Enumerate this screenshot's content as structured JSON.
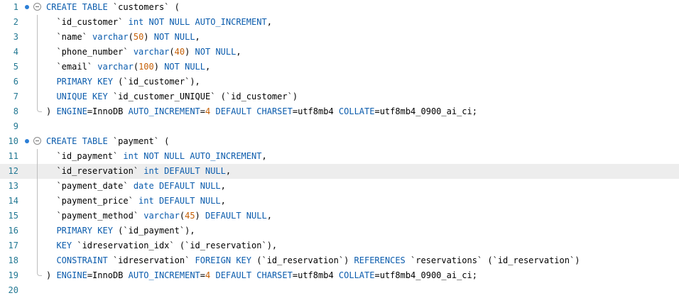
{
  "editor": {
    "highlighted_line": 12,
    "colors": {
      "keyword": "#0b5cad",
      "identifier": "#000000",
      "number": "#c55f05",
      "line_number": "#237893",
      "breakpoint": "#2c7fd6"
    },
    "lines": [
      {
        "n": "1",
        "bp": true,
        "fold": "open",
        "tokens": [
          [
            "kw",
            "CREATE TABLE "
          ],
          [
            "id",
            "`customers` "
          ],
          [
            "pl",
            "("
          ]
        ]
      },
      {
        "n": "2",
        "fold": "guide",
        "tokens": [
          [
            "pl",
            "  "
          ],
          [
            "id",
            "`id_customer` "
          ],
          [
            "kw",
            "int NOT NULL AUTO_INCREMENT"
          ],
          [
            "pl",
            ","
          ]
        ]
      },
      {
        "n": "3",
        "fold": "guide",
        "tokens": [
          [
            "pl",
            "  "
          ],
          [
            "id",
            "`name` "
          ],
          [
            "kw",
            "varchar"
          ],
          [
            "pl",
            "("
          ],
          [
            "num",
            "50"
          ],
          [
            "pl",
            ") "
          ],
          [
            "kw",
            "NOT NULL"
          ],
          [
            "pl",
            ","
          ]
        ]
      },
      {
        "n": "4",
        "fold": "guide",
        "tokens": [
          [
            "pl",
            "  "
          ],
          [
            "id",
            "`phone_number` "
          ],
          [
            "kw",
            "varchar"
          ],
          [
            "pl",
            "("
          ],
          [
            "num",
            "40"
          ],
          [
            "pl",
            ") "
          ],
          [
            "kw",
            "NOT NULL"
          ],
          [
            "pl",
            ","
          ]
        ]
      },
      {
        "n": "5",
        "fold": "guide",
        "tokens": [
          [
            "pl",
            "  "
          ],
          [
            "id",
            "`email` "
          ],
          [
            "kw",
            "varchar"
          ],
          [
            "pl",
            "("
          ],
          [
            "num",
            "100"
          ],
          [
            "pl",
            ") "
          ],
          [
            "kw",
            "NOT NULL"
          ],
          [
            "pl",
            ","
          ]
        ]
      },
      {
        "n": "6",
        "fold": "guide",
        "tokens": [
          [
            "pl",
            "  "
          ],
          [
            "kw",
            "PRIMARY KEY "
          ],
          [
            "pl",
            "("
          ],
          [
            "id",
            "`id_customer`"
          ],
          [
            "pl",
            "),"
          ]
        ]
      },
      {
        "n": "7",
        "fold": "guide",
        "tokens": [
          [
            "pl",
            "  "
          ],
          [
            "kw",
            "UNIQUE KEY "
          ],
          [
            "id",
            "`id_customer_UNIQUE` "
          ],
          [
            "pl",
            "("
          ],
          [
            "id",
            "`id_customer`"
          ],
          [
            "pl",
            ")"
          ]
        ]
      },
      {
        "n": "8",
        "fold": "end",
        "tokens": [
          [
            "pl",
            ") "
          ],
          [
            "kw",
            "ENGINE"
          ],
          [
            "pl",
            "="
          ],
          [
            "id",
            "InnoDB "
          ],
          [
            "kw",
            "AUTO_INCREMENT"
          ],
          [
            "pl",
            "="
          ],
          [
            "num",
            "4"
          ],
          [
            "pl",
            " "
          ],
          [
            "kw",
            "DEFAULT CHARSET"
          ],
          [
            "pl",
            "="
          ],
          [
            "id",
            "utf8mb4 "
          ],
          [
            "kw",
            "COLLATE"
          ],
          [
            "pl",
            "="
          ],
          [
            "id",
            "utf8mb4_0900_ai_ci"
          ],
          [
            "pl",
            ";"
          ]
        ]
      },
      {
        "n": "9",
        "tokens": []
      },
      {
        "n": "10",
        "bp": true,
        "fold": "open",
        "tokens": [
          [
            "kw",
            "CREATE TABLE "
          ],
          [
            "id",
            "`payment` "
          ],
          [
            "pl",
            "("
          ]
        ]
      },
      {
        "n": "11",
        "fold": "guide",
        "tokens": [
          [
            "pl",
            "  "
          ],
          [
            "id",
            "`id_payment` "
          ],
          [
            "kw",
            "int NOT NULL AUTO_INCREMENT"
          ],
          [
            "pl",
            ","
          ]
        ]
      },
      {
        "n": "12",
        "fold": "guide",
        "tokens": [
          [
            "pl",
            "  "
          ],
          [
            "id",
            "`id_reservation` "
          ],
          [
            "kw",
            "int DEFAULT NULL"
          ],
          [
            "pl",
            ","
          ]
        ]
      },
      {
        "n": "13",
        "fold": "guide",
        "tokens": [
          [
            "pl",
            "  "
          ],
          [
            "id",
            "`payment_date` "
          ],
          [
            "kw",
            "date DEFAULT NULL"
          ],
          [
            "pl",
            ","
          ]
        ]
      },
      {
        "n": "14",
        "fold": "guide",
        "tokens": [
          [
            "pl",
            "  "
          ],
          [
            "id",
            "`payment_price` "
          ],
          [
            "kw",
            "int DEFAULT NULL"
          ],
          [
            "pl",
            ","
          ]
        ]
      },
      {
        "n": "15",
        "fold": "guide",
        "tokens": [
          [
            "pl",
            "  "
          ],
          [
            "id",
            "`payment_method` "
          ],
          [
            "kw",
            "varchar"
          ],
          [
            "pl",
            "("
          ],
          [
            "num",
            "45"
          ],
          [
            "pl",
            ") "
          ],
          [
            "kw",
            "DEFAULT NULL"
          ],
          [
            "pl",
            ","
          ]
        ]
      },
      {
        "n": "16",
        "fold": "guide",
        "tokens": [
          [
            "pl",
            "  "
          ],
          [
            "kw",
            "PRIMARY KEY "
          ],
          [
            "pl",
            "("
          ],
          [
            "id",
            "`id_payment`"
          ],
          [
            "pl",
            "),"
          ]
        ]
      },
      {
        "n": "17",
        "fold": "guide",
        "tokens": [
          [
            "pl",
            "  "
          ],
          [
            "kw",
            "KEY "
          ],
          [
            "id",
            "`idreservation_idx` "
          ],
          [
            "pl",
            "("
          ],
          [
            "id",
            "`id_reservation`"
          ],
          [
            "pl",
            "),"
          ]
        ]
      },
      {
        "n": "18",
        "fold": "guide",
        "tokens": [
          [
            "pl",
            "  "
          ],
          [
            "kw",
            "CONSTRAINT "
          ],
          [
            "id",
            "`idreservation` "
          ],
          [
            "kw",
            "FOREIGN KEY "
          ],
          [
            "pl",
            "("
          ],
          [
            "id",
            "`id_reservation`"
          ],
          [
            "pl",
            ") "
          ],
          [
            "kw",
            "REFERENCES "
          ],
          [
            "id",
            "`reservations` "
          ],
          [
            "pl",
            "("
          ],
          [
            "id",
            "`id_reservation`"
          ],
          [
            "pl",
            ")"
          ]
        ]
      },
      {
        "n": "19",
        "fold": "end",
        "tokens": [
          [
            "pl",
            ") "
          ],
          [
            "kw",
            "ENGINE"
          ],
          [
            "pl",
            "="
          ],
          [
            "id",
            "InnoDB "
          ],
          [
            "kw",
            "AUTO_INCREMENT"
          ],
          [
            "pl",
            "="
          ],
          [
            "num",
            "4"
          ],
          [
            "pl",
            " "
          ],
          [
            "kw",
            "DEFAULT CHARSET"
          ],
          [
            "pl",
            "="
          ],
          [
            "id",
            "utf8mb4 "
          ],
          [
            "kw",
            "COLLATE"
          ],
          [
            "pl",
            "="
          ],
          [
            "id",
            "utf8mb4_0900_ai_ci"
          ],
          [
            "pl",
            ";"
          ]
        ]
      },
      {
        "n": "20",
        "tokens": []
      }
    ]
  }
}
